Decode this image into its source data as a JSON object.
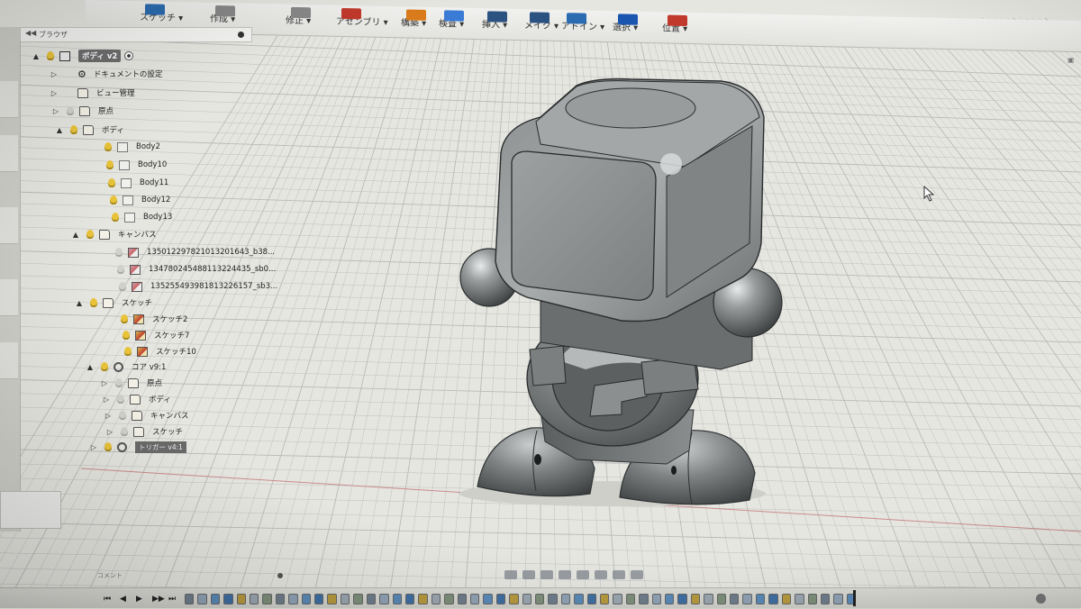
{
  "toolbar": {
    "items": [
      {
        "label": "スケッチ ▾",
        "icon": "sketch-icon",
        "color": "#2b6cb0"
      },
      {
        "label": "作成 ▾",
        "icon": "create-icon",
        "color": "#888888"
      },
      {
        "label": "修正 ▾",
        "icon": "modify-icon",
        "color": "#888888"
      },
      {
        "label": "アセンブリ ▾",
        "icon": "assemble-icon",
        "color": "#c0392b"
      },
      {
        "label": "構築 ▾",
        "icon": "construct-icon",
        "color": "#d97b1a"
      },
      {
        "label": "検査 ▾",
        "icon": "inspect-icon",
        "color": "#3a7bd5"
      },
      {
        "label": "挿入 ▾",
        "icon": "insert-icon",
        "color": "#2c5282"
      },
      {
        "label": "メイク ▾",
        "icon": "make-icon",
        "color": "#2c5282"
      },
      {
        "label": "アドイン ▾",
        "icon": "addins-icon",
        "color": "#2b6cb0"
      },
      {
        "label": "選択 ▾",
        "icon": "select-icon",
        "color": "#1a56b0"
      },
      {
        "label": "位置 ▾",
        "icon": "position-icon",
        "color": "#c0392b"
      }
    ]
  },
  "browser": {
    "title": "ブラウザ",
    "collapse_glyph": "◀◀",
    "tree": [
      {
        "label": "ボディ v2",
        "expander": "▲",
        "bulb": true,
        "icon": "comp",
        "selected": true,
        "radio": true
      },
      {
        "label": "ドキュメントの設定",
        "expander": "▷",
        "bulb": false,
        "icon": "gear"
      },
      {
        "label": "ビュー管理",
        "expander": "▷",
        "bulb": false,
        "icon": "folder"
      },
      {
        "label": "原点",
        "expander": "▷",
        "bulb": true,
        "icon": "folder",
        "bulb_off": true
      },
      {
        "label": "ボディ",
        "expander": "▲",
        "bulb": true,
        "icon": "folder"
      },
      {
        "label": "Body2",
        "expander": "",
        "bulb": true,
        "icon": "body"
      },
      {
        "label": "Body10",
        "expander": "",
        "bulb": true,
        "icon": "body"
      },
      {
        "label": "Body11",
        "expander": "",
        "bulb": true,
        "icon": "body"
      },
      {
        "label": "Body12",
        "expander": "",
        "bulb": true,
        "icon": "body"
      },
      {
        "label": "Body13",
        "expander": "",
        "bulb": true,
        "icon": "body"
      },
      {
        "label": "キャンバス",
        "expander": "▲",
        "bulb": true,
        "icon": "folder"
      },
      {
        "label": "135012297821013201643_b38...",
        "expander": "",
        "bulb": true,
        "icon": "canvas",
        "bulb_off": true
      },
      {
        "label": "134780245488113224435_sb0...",
        "expander": "",
        "bulb": true,
        "icon": "canvas",
        "bulb_off": true
      },
      {
        "label": "135255493981813226157_sb3...",
        "expander": "",
        "bulb": true,
        "icon": "canvas",
        "bulb_off": true
      },
      {
        "label": "スケッチ",
        "expander": "▲",
        "bulb": true,
        "icon": "folder"
      },
      {
        "label": "スケッチ2",
        "expander": "",
        "bulb": true,
        "icon": "sketch"
      },
      {
        "label": "スケッチ7",
        "expander": "",
        "bulb": true,
        "icon": "sketch"
      },
      {
        "label": "スケッチ10",
        "expander": "",
        "bulb": true,
        "icon": "sketch"
      },
      {
        "label": "コア v9:1",
        "expander": "▲",
        "bulb": true,
        "icon": "link"
      },
      {
        "label": "原点",
        "expander": "▷",
        "bulb": true,
        "icon": "folder",
        "bulb_off": true
      },
      {
        "label": "ボディ",
        "expander": "▷",
        "bulb": true,
        "icon": "folder",
        "bulb_off": true
      },
      {
        "label": "キャンバス",
        "expander": "▷",
        "bulb": true,
        "icon": "folder",
        "bulb_off": true
      },
      {
        "label": "スケッチ",
        "expander": "▷",
        "bulb": true,
        "icon": "folder",
        "bulb_off": true
      },
      {
        "label": "トリガー v4:1",
        "expander": "▷",
        "bulb": true,
        "icon": "link",
        "tag": true
      }
    ]
  },
  "comment_label": "コメント",
  "timeline": {
    "controls": [
      "⏮",
      "◀",
      "▶",
      "▶▶",
      "⏭"
    ],
    "feature_count": 52
  },
  "colors": {
    "grid_line": "#b9bbb8",
    "model_dark": "#4a4d4e",
    "model_mid": "#7d8182",
    "model_light": "#b8bcbc",
    "selected_row": "#6d6d6d",
    "bulb_on": "#e8c33a"
  }
}
